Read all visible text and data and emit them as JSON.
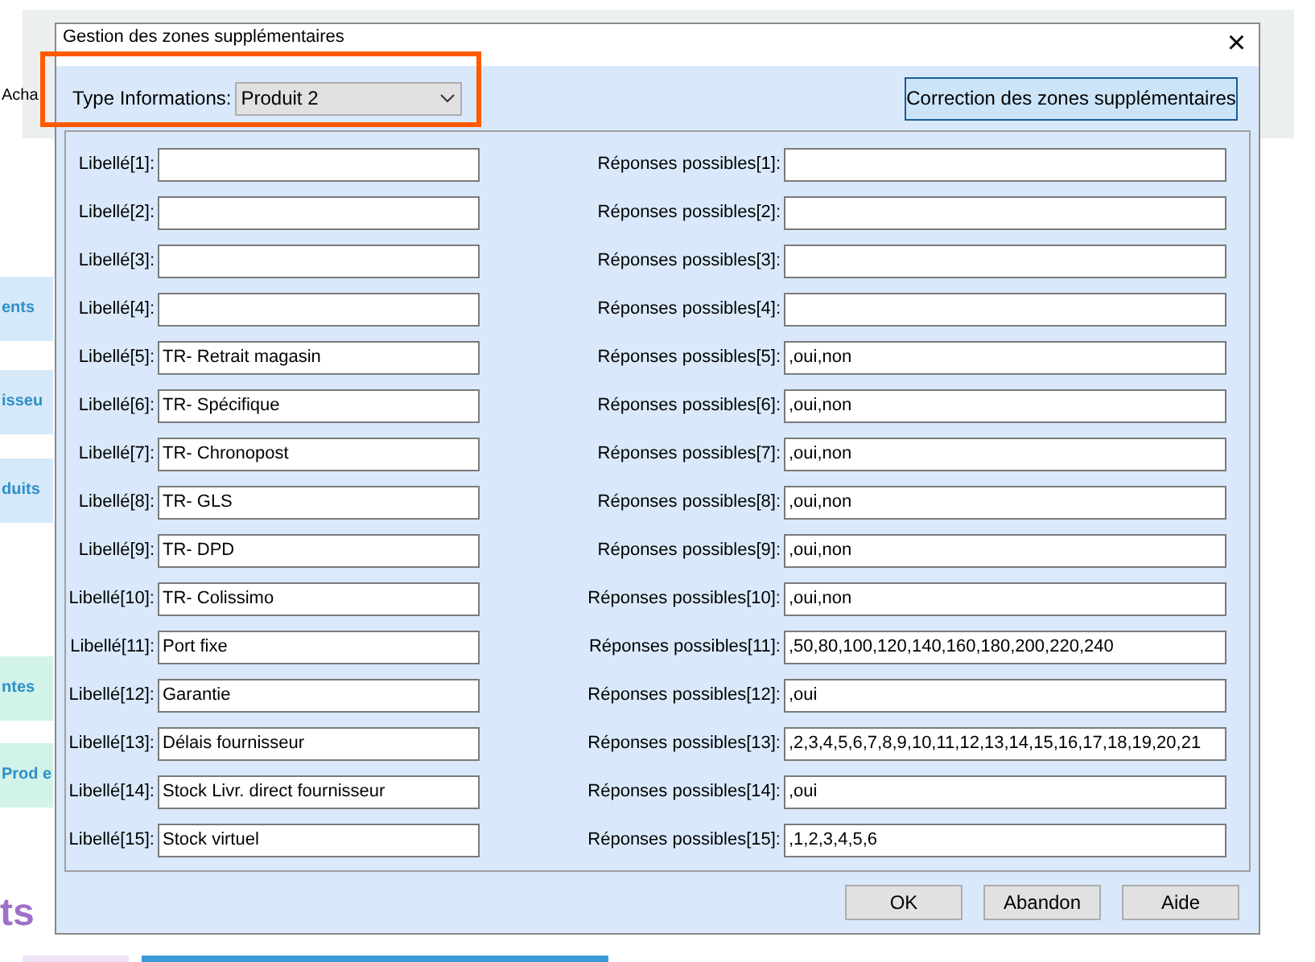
{
  "background": {
    "toolbar_text": "Acha",
    "tiles": [
      {
        "text": "ents",
        "color": "#d6e9f8"
      },
      {
        "text": "isseu",
        "color": "#d6e9f8"
      },
      {
        "text": "duits",
        "color": "#d6e9f8"
      },
      {
        "text": "ntes",
        "color": "#d2f3ea"
      },
      {
        "text": "Prod e",
        "color": "#d2f3ea"
      }
    ],
    "footer_text": "ts"
  },
  "dialog": {
    "title": "Gestion des zones supplémentaires",
    "close": "×",
    "type_informations": {
      "label": "Type Informations:",
      "value": "Produit 2"
    },
    "correction_button": "Correction des zones supplémentaires",
    "rows": [
      {
        "label": "Libellé[1]:",
        "value": "",
        "responses_label": "Réponses possibles[1]:",
        "responses_value": ""
      },
      {
        "label": "Libellé[2]:",
        "value": "",
        "responses_label": "Réponses possibles[2]:",
        "responses_value": ""
      },
      {
        "label": "Libellé[3]:",
        "value": "",
        "responses_label": "Réponses possibles[3]:",
        "responses_value": ""
      },
      {
        "label": "Libellé[4]:",
        "value": "",
        "responses_label": "Réponses possibles[4]:",
        "responses_value": ""
      },
      {
        "label": "Libellé[5]:",
        "value": "TR- Retrait magasin",
        "responses_label": "Réponses possibles[5]:",
        "responses_value": ",oui,non"
      },
      {
        "label": "Libellé[6]:",
        "value": "TR- Spécifique",
        "responses_label": "Réponses possibles[6]:",
        "responses_value": ",oui,non"
      },
      {
        "label": "Libellé[7]:",
        "value": "TR- Chronopost",
        "responses_label": "Réponses possibles[7]:",
        "responses_value": ",oui,non"
      },
      {
        "label": "Libellé[8]:",
        "value": "TR- GLS",
        "responses_label": "Réponses possibles[8]:",
        "responses_value": ",oui,non"
      },
      {
        "label": "Libellé[9]:",
        "value": "TR- DPD",
        "responses_label": "Réponses possibles[9]:",
        "responses_value": ",oui,non"
      },
      {
        "label": "Libellé[10]:",
        "value": "TR- Colissimo",
        "responses_label": "Réponses possibles[10]:",
        "responses_value": ",oui,non"
      },
      {
        "label": "Libellé[11]:",
        "value": "Port fixe",
        "responses_label": "Réponses possibles[11]:",
        "responses_value": ",50,80,100,120,140,160,180,200,220,240"
      },
      {
        "label": "Libellé[12]:",
        "value": "Garantie",
        "responses_label": "Réponses possibles[12]:",
        "responses_value": ",oui"
      },
      {
        "label": "Libellé[13]:",
        "value": "Délais fournisseur",
        "responses_label": "Réponses possibles[13]:",
        "responses_value": ",2,3,4,5,6,7,8,9,10,11,12,13,14,15,16,17,18,19,20,21"
      },
      {
        "label": "Libellé[14]:",
        "value": "Stock Livr. direct fournisseur",
        "responses_label": "Réponses possibles[14]:",
        "responses_value": ",oui"
      },
      {
        "label": "Libellé[15]:",
        "value": "Stock virtuel",
        "responses_label": "Réponses possibles[15]:",
        "responses_value": ",1,2,3,4,5,6"
      }
    ],
    "buttons": [
      "OK",
      "Abandon",
      "Aide"
    ]
  }
}
